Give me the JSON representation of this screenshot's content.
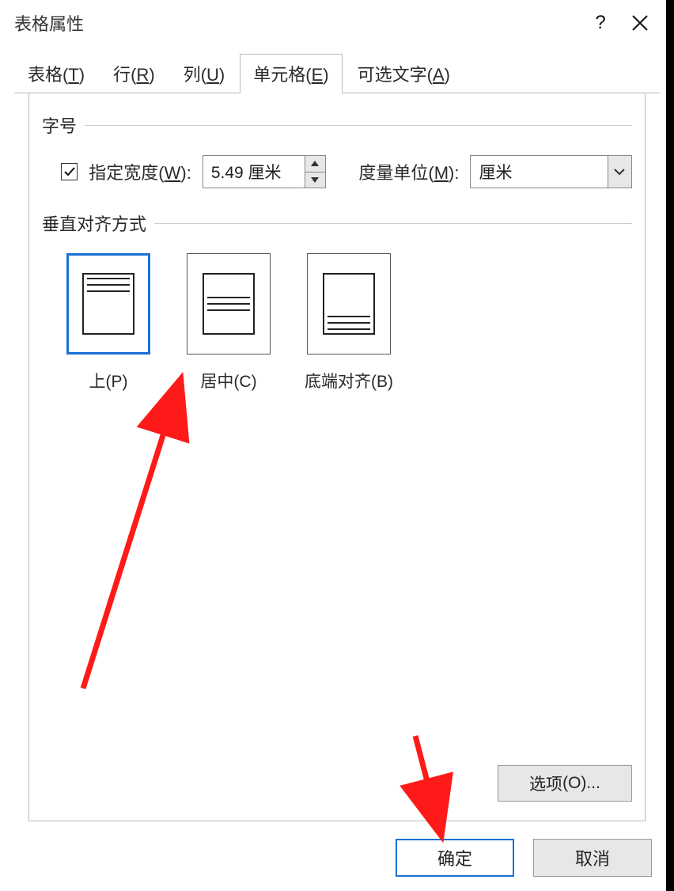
{
  "title": "表格属性",
  "help_icon": "?",
  "tabs": {
    "table": {
      "label": "表格",
      "key": "T"
    },
    "row": {
      "label": "行",
      "key": "R"
    },
    "column": {
      "label": "列",
      "key": "U"
    },
    "cell": {
      "label": "单元格",
      "key": "E"
    },
    "alttext": {
      "label": "可选文字",
      "key": "A"
    }
  },
  "active_tab": "cell",
  "size": {
    "group_label": "字号",
    "pref_width": {
      "label": "指定宽度",
      "key": "W",
      "checked": true,
      "value": "5.49 厘米"
    },
    "unit": {
      "label": "度量单位",
      "key": "M",
      "value": "厘米"
    }
  },
  "valign": {
    "group_label": "垂直对齐方式",
    "selected": "top",
    "options": {
      "top": {
        "label": "上",
        "key": "P"
      },
      "center": {
        "label": "居中",
        "key": "C"
      },
      "bottom": {
        "label": "底端对齐",
        "key": "B"
      }
    }
  },
  "options_button": {
    "label": "选项",
    "key": "O",
    "suffix": "..."
  },
  "footer": {
    "ok": "确定",
    "cancel": "取消"
  }
}
